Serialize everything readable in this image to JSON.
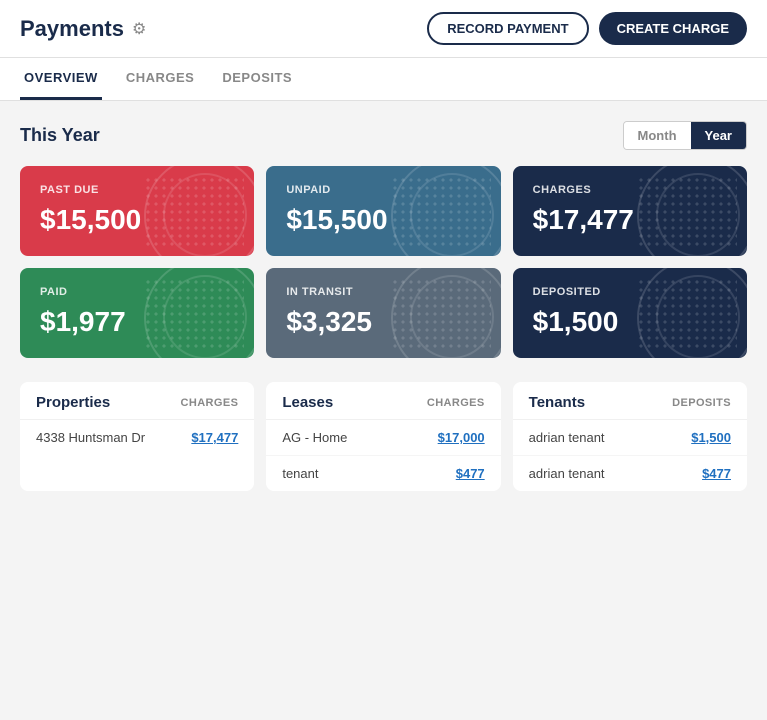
{
  "header": {
    "title": "Payments",
    "gear_icon": "⚙",
    "btn_record": "RECORD PAYMENT",
    "btn_create": "CREATE CHARGE"
  },
  "tabs": [
    {
      "id": "overview",
      "label": "OVERVIEW",
      "active": true
    },
    {
      "id": "charges",
      "label": "CHARGES",
      "active": false
    },
    {
      "id": "deposits",
      "label": "DEPOSITS",
      "active": false
    }
  ],
  "section": {
    "title": "This Year",
    "toggle": {
      "month_label": "Month",
      "year_label": "Year",
      "active": "year"
    }
  },
  "cards": [
    {
      "id": "past-due",
      "label": "PAST DUE",
      "value": "$15,500",
      "color": "card-red"
    },
    {
      "id": "unpaid",
      "label": "UNPAID",
      "value": "$15,500",
      "color": "card-steel"
    },
    {
      "id": "charges",
      "label": "CHARGES",
      "value": "$17,477",
      "color": "card-navy"
    },
    {
      "id": "paid",
      "label": "PAID",
      "value": "$1,977",
      "color": "card-green"
    },
    {
      "id": "in-transit",
      "label": "IN TRANSIT",
      "value": "$3,325",
      "color": "card-gray"
    },
    {
      "id": "deposited",
      "label": "DEPOSITED",
      "value": "$1,500",
      "color": "card-dark-navy"
    }
  ],
  "tables": [
    {
      "id": "properties",
      "title": "Properties",
      "col_label": "CHARGES",
      "rows": [
        {
          "name": "4338 Huntsman Dr",
          "value": "$17,477"
        }
      ]
    },
    {
      "id": "leases",
      "title": "Leases",
      "col_label": "CHARGES",
      "rows": [
        {
          "name": "AG - Home",
          "value": "$17,000"
        },
        {
          "name": "tenant",
          "value": "$477"
        }
      ]
    },
    {
      "id": "tenants",
      "title": "Tenants",
      "col_label": "DEPOSITS",
      "rows": [
        {
          "name": "adrian tenant",
          "value": "$1,500"
        },
        {
          "name": "adrian tenant",
          "value": "$477"
        }
      ]
    }
  ]
}
